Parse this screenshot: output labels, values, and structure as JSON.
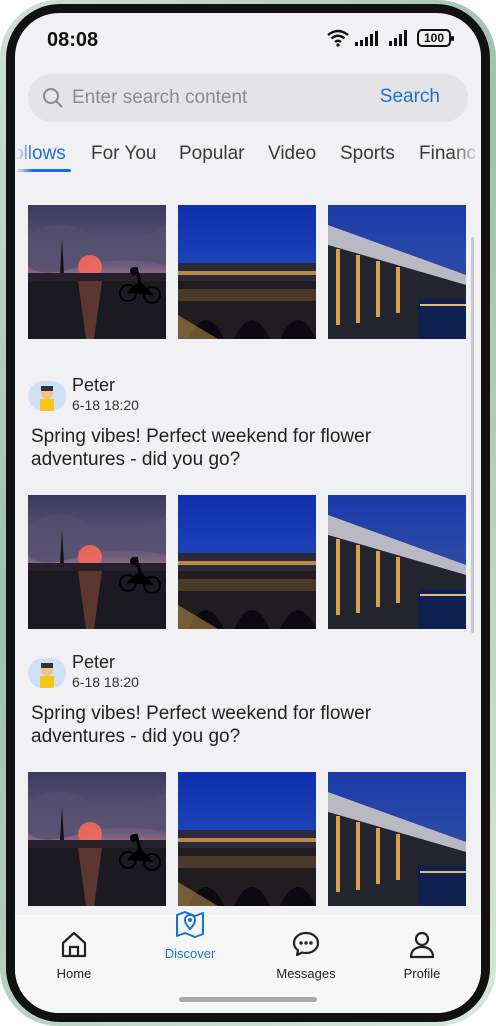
{
  "status_bar": {
    "time": "08:08",
    "battery": "100"
  },
  "search": {
    "placeholder": "Enter search content",
    "button_label": "Search"
  },
  "tabs": [
    {
      "label": "ollows",
      "active": true
    },
    {
      "label": "For You"
    },
    {
      "label": "Popular"
    },
    {
      "label": "Video"
    },
    {
      "label": "Sports"
    },
    {
      "label": "Financ"
    }
  ],
  "posts": [
    {
      "author": "Peter",
      "time": "6-18 18:20",
      "text": "Spring vibes! Perfect weekend for flower adventures - did you go?"
    },
    {
      "author": "Peter",
      "time": "6-18 18:20",
      "text": "Spring vibes! Perfect weekend for flower adventures - did you go?"
    }
  ],
  "nav": [
    {
      "label": "Home",
      "icon": "home-icon"
    },
    {
      "label": "Discover",
      "icon": "map-icon",
      "active": true
    },
    {
      "label": "Messages",
      "icon": "chat-icon"
    },
    {
      "label": "Profile",
      "icon": "person-icon"
    }
  ],
  "colors": {
    "accent": "#1a6fd9",
    "background": "#f1f1f3"
  }
}
